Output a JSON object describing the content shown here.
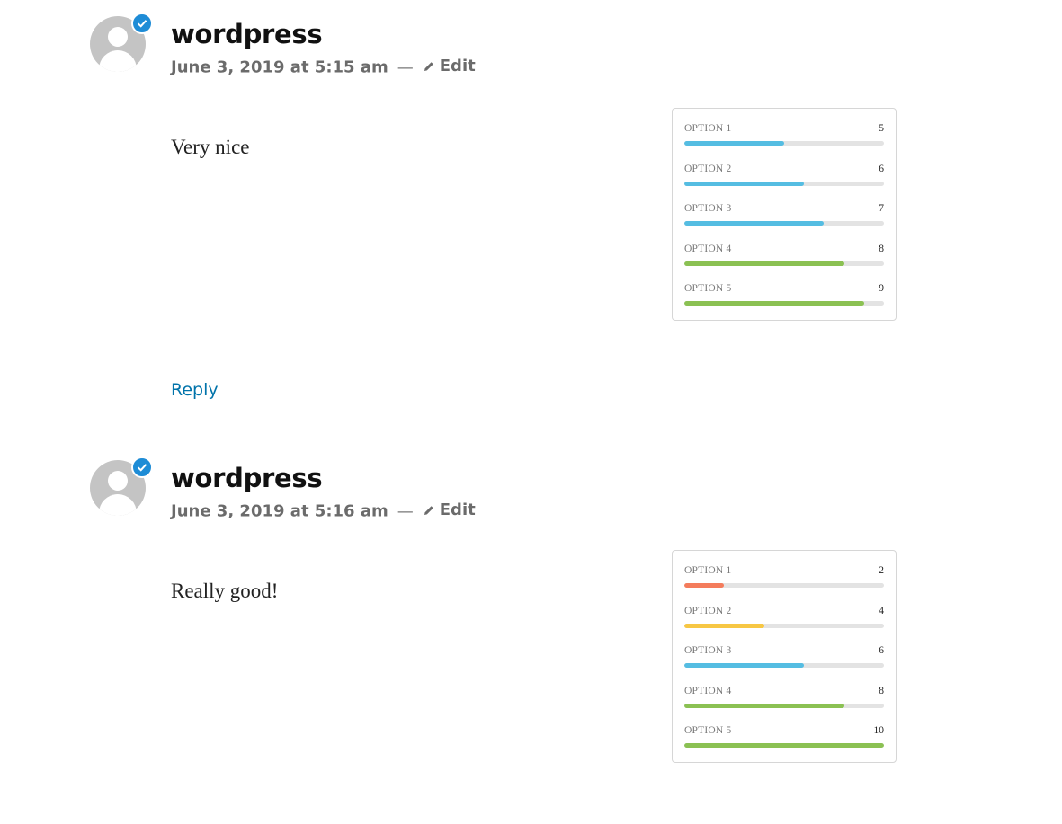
{
  "comments": [
    {
      "author": "wordpress",
      "date": "June 3, 2019 at 5:15 am",
      "separator": "—",
      "edit_label": "Edit",
      "text": "Very nice",
      "reply_label": "Reply",
      "ratings": [
        {
          "label": "OPTION 1",
          "value": 5,
          "color": "#55bde2"
        },
        {
          "label": "OPTION 2",
          "value": 6,
          "color": "#55bde2"
        },
        {
          "label": "OPTION 3",
          "value": 7,
          "color": "#55bde2"
        },
        {
          "label": "OPTION 4",
          "value": 8,
          "color": "#8bc153"
        },
        {
          "label": "OPTION 5",
          "value": 9,
          "color": "#8bc153"
        }
      ]
    },
    {
      "author": "wordpress",
      "date": "June 3, 2019 at 5:16 am",
      "separator": "—",
      "edit_label": "Edit",
      "text": "Really good!",
      "ratings": [
        {
          "label": "OPTION 1",
          "value": 2,
          "color": "#f47c5c"
        },
        {
          "label": "OPTION 2",
          "value": 4,
          "color": "#f7c744"
        },
        {
          "label": "OPTION 3",
          "value": 6,
          "color": "#55bde2"
        },
        {
          "label": "OPTION 4",
          "value": 8,
          "color": "#8bc153"
        },
        {
          "label": "OPTION 5",
          "value": 10,
          "color": "#8bc153"
        }
      ]
    }
  ],
  "rating_max": 10,
  "colors": {
    "link": "#0073aa",
    "badge": "#1e8cd6",
    "avatar": "#c4c4c4"
  }
}
